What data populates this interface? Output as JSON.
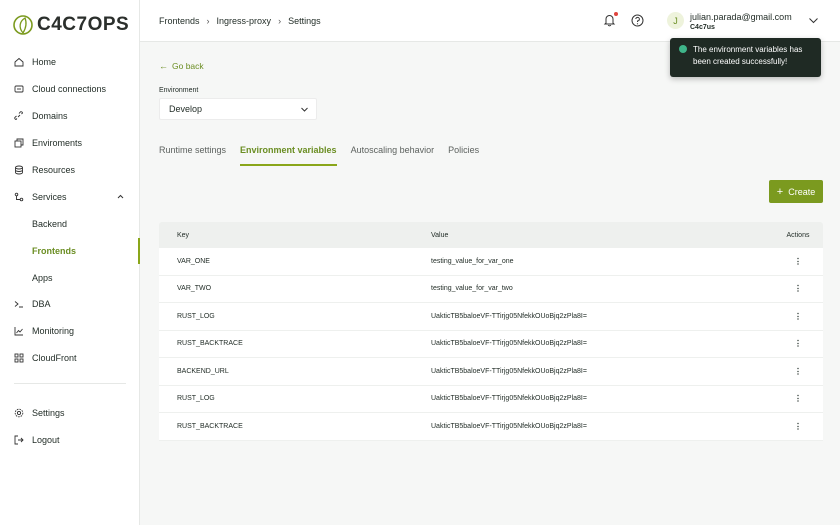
{
  "brand": {
    "name": "C4C7OPS"
  },
  "sidebar": {
    "items": [
      {
        "label": "Home",
        "icon": "home-icon"
      },
      {
        "label": "Cloud connections",
        "icon": "cloud-connections-icon"
      },
      {
        "label": "Domains",
        "icon": "link-icon"
      },
      {
        "label": "Enviroments",
        "icon": "environments-icon"
      },
      {
        "label": "Resources",
        "icon": "database-icon"
      },
      {
        "label": "Services",
        "icon": "services-icon",
        "expanded": true
      },
      {
        "label": "Backend",
        "sub": true
      },
      {
        "label": "Frontends",
        "sub": true,
        "active": true
      },
      {
        "label": "Apps",
        "sub": true
      },
      {
        "label": "DBA",
        "icon": "terminal-icon"
      },
      {
        "label": "Monitoring",
        "icon": "chart-icon"
      },
      {
        "label": "CloudFront",
        "icon": "cloudfront-icon"
      }
    ],
    "bottom": [
      {
        "label": "Settings",
        "icon": "gear-icon"
      },
      {
        "label": "Logout",
        "icon": "logout-icon"
      }
    ]
  },
  "breadcrumb": [
    "Frontends",
    "Ingress-proxy",
    "Settings"
  ],
  "user": {
    "initial": "J",
    "email": "julian.parada@gmail.com",
    "org": "C4c7us"
  },
  "toast": {
    "message": "The environment variables has been created successfully!"
  },
  "page": {
    "go_back": "Go back",
    "environment_label": "Environment",
    "environment_value": "Develop",
    "tabs": [
      "Runtime settings",
      "Environment variables",
      "Autoscaling behavior",
      "Policies"
    ],
    "active_tab": 1,
    "create_label": "Create"
  },
  "table": {
    "headers": {
      "key": "Key",
      "value": "Value",
      "actions": "Actions"
    },
    "rows": [
      {
        "key": "VAR_ONE",
        "value": "testing_value_for_var_one"
      },
      {
        "key": "VAR_TWO",
        "value": "testing_value_for_var_two"
      },
      {
        "key": "RUST_LOG",
        "value": "UakticTB5baloeVF-TTirjg05NfekkOUoBjq2zPla8I="
      },
      {
        "key": "RUST_BACKTRACE",
        "value": "UakticTB5baloeVF-TTirjg05NfekkOUoBjq2zPla8I="
      },
      {
        "key": "BACKEND_URL",
        "value": "UakticTB5baloeVF-TTirjg05NfekkOUoBjq2zPla8I="
      },
      {
        "key": "RUST_LOG",
        "value": "UakticTB5baloeVF-TTirjg05NfekkOUoBjq2zPla8I="
      },
      {
        "key": "RUST_BACKTRACE",
        "value": "UakticTB5baloeVF-TTirjg05NfekkOUoBjq2zPla8I="
      }
    ]
  },
  "colors": {
    "accent": "#7b9a1f",
    "accent_text": "#6b8e23",
    "toast_bg": "#1f2a24",
    "toast_ok": "#3fb58a",
    "notification": "#e0443e"
  }
}
